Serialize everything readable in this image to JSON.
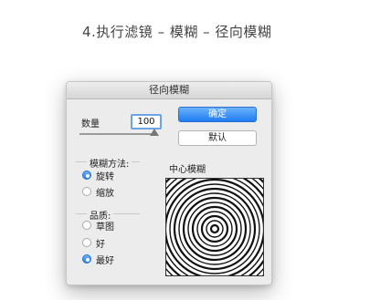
{
  "step_title": "4.执行滤镜 – 模糊 – 径向模糊",
  "dialog": {
    "title": "径向模糊",
    "amount_label": "数量",
    "amount_value": "100",
    "amount_fraction": 1.0,
    "ok_label": "确定",
    "default_label": "默认",
    "blur_method": {
      "title": "模糊方法:",
      "options": [
        "旋转",
        "缩放"
      ],
      "selected": "旋转"
    },
    "quality": {
      "title": "品质:",
      "options": [
        "草图",
        "好",
        "最好"
      ],
      "selected": "最好"
    },
    "center_label": "中心模糊"
  },
  "colors": {
    "accent": "#2b7ef0",
    "dialog_bg": "#ececec"
  }
}
